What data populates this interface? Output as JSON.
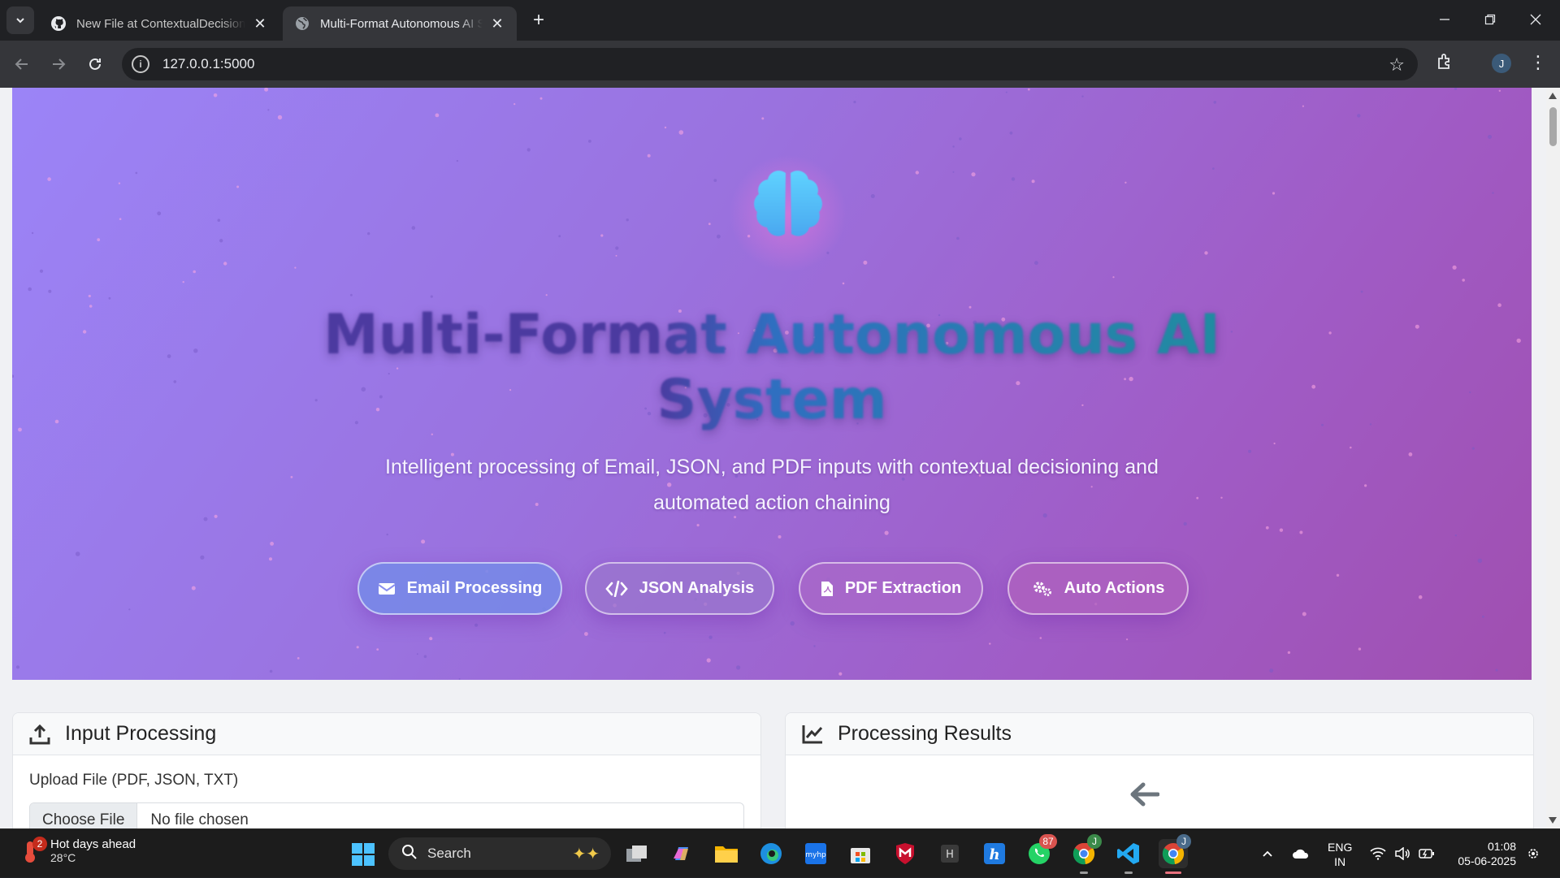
{
  "browser": {
    "tabs": [
      {
        "title": "New File at ContextualDecisionEngine",
        "active": false,
        "icon": "github-icon"
      },
      {
        "title": "Multi-Format Autonomous AI System",
        "active": true,
        "icon": "globe-icon"
      }
    ],
    "url": "127.0.0.1:5000",
    "profile_initial": "J"
  },
  "hero": {
    "icon": "brain-icon",
    "title": "Multi-Format Autonomous AI System",
    "subtitle": "Intelligent processing of Email, JSON, and PDF inputs with contextual decisioning and automated action chaining",
    "features": [
      {
        "label": "Email Processing",
        "icon": "envelope-icon"
      },
      {
        "label": "JSON Analysis",
        "icon": "code-icon"
      },
      {
        "label": "PDF Extraction",
        "icon": "pdf-file-icon"
      },
      {
        "label": "Auto Actions",
        "icon": "cogs-icon"
      }
    ],
    "colors": {
      "gradient_start": "#9b84f7",
      "gradient_end": "#a04fb0"
    }
  },
  "input_panel": {
    "title": "Input Processing",
    "upload_label": "Upload File (PDF, JSON, TXT)",
    "file_button": "Choose File",
    "file_status": "No file chosen"
  },
  "results_panel": {
    "title": "Processing Results"
  },
  "taskbar": {
    "weather": {
      "title": "Hot days ahead",
      "temp": "28°C",
      "badge": "2"
    },
    "search_placeholder": "Search",
    "whatsapp_badge": "87",
    "chrome_badge": "J",
    "language": {
      "line1": "ENG",
      "line2": "IN"
    },
    "time": "01:08",
    "date": "05-06-2025"
  }
}
